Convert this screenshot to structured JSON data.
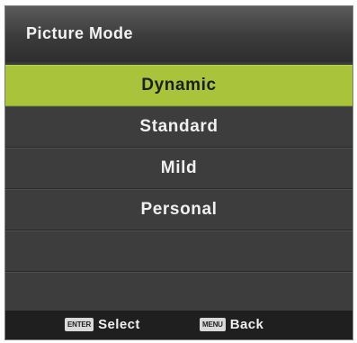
{
  "header": {
    "title": "Picture Mode"
  },
  "menu": {
    "items": [
      {
        "label": "Dynamic",
        "selected": true
      },
      {
        "label": "Standard",
        "selected": false
      },
      {
        "label": "Mild",
        "selected": false
      },
      {
        "label": "Personal",
        "selected": false
      },
      {
        "label": "",
        "selected": false
      },
      {
        "label": "",
        "selected": false
      }
    ]
  },
  "footer": {
    "enter_key": "ENTER",
    "enter_label": "Select",
    "menu_key": "MENU",
    "menu_label": "Back"
  },
  "colors": {
    "highlight": "#a9c43b",
    "panel": "#3d3d3d",
    "footer": "#1f1f1f"
  }
}
